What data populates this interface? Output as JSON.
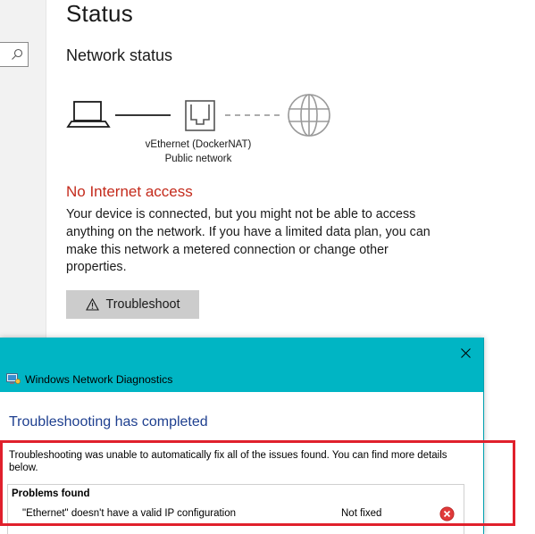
{
  "settings": {
    "page_title": "Status",
    "section_title": "Network status",
    "adapter_name": "vEthernet (DockerNAT)",
    "network_type": "Public network",
    "status_heading": "No Internet access",
    "status_description": "Your device is connected, but you might not be able to access anything on the network. If you have a limited data plan, you can make this network a metered connection or change other properties.",
    "troubleshoot_label": "Troubleshoot",
    "search_icon": "search-icon"
  },
  "dialog": {
    "title": "Windows Network Diagnostics",
    "heading": "Troubleshooting has completed",
    "message": "Troubleshooting was unable to automatically fix all of the issues found. You can find more details below.",
    "problems_header": "Problems found",
    "problems": [
      {
        "description": "\"Ethernet\" doesn't have a valid IP configuration",
        "status": "Not fixed",
        "icon": "error-icon"
      }
    ]
  },
  "colors": {
    "accent_titlebar": "#00b5c4",
    "error_text": "#c42b1c",
    "dialog_heading": "#1e3f8f",
    "highlight": "#e0202c",
    "button_bg": "#cccccc"
  }
}
